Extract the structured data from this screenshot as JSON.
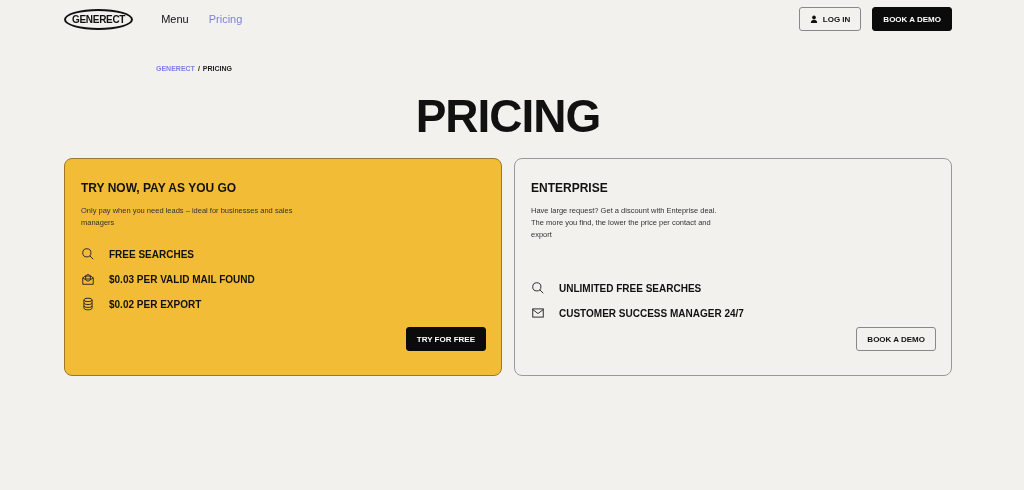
{
  "header": {
    "logo": "GENERECT",
    "nav": [
      {
        "label": "Menu",
        "selected": false
      },
      {
        "label": "Pricing",
        "selected": true
      }
    ],
    "login": "LOG IN",
    "demo": "BOOK A DEMO"
  },
  "breadcrumb": [
    {
      "label": "GENERECT",
      "kind": "link"
    },
    {
      "label": "/",
      "kind": "separator"
    },
    {
      "label": "PRICING",
      "kind": "current"
    }
  ],
  "title": "PRICING",
  "plans": [
    {
      "kind": "highlight",
      "title": "TRY NOW, PAY AS YOU GO",
      "description": "Only pay when you need leads – ideal for businesses and sales managers",
      "features": [
        {
          "kind": "search",
          "label": "FREE SEARCHES"
        },
        {
          "kind": "mail-open",
          "label": "$0.03 PER VALID MAIL FOUND"
        },
        {
          "kind": "coins",
          "label": "$0.02 PER EXPORT"
        }
      ],
      "button": {
        "kind": "dark",
        "label": "TRY FOR FREE"
      }
    },
    {
      "kind": "plain",
      "title": "ENTERPRISE",
      "description": "Have large request? Get a discount with Enteprise deal. The more you find, the lower the price per contact and export",
      "features": [
        {
          "kind": "search",
          "label": "UNLIMITED FREE SEARCHES"
        },
        {
          "kind": "mail",
          "label": "CUSTOMER SUCCESS MANAGER 24/7"
        }
      ],
      "button": {
        "kind": "outline",
        "label": "BOOK A DEMO"
      }
    }
  ]
}
